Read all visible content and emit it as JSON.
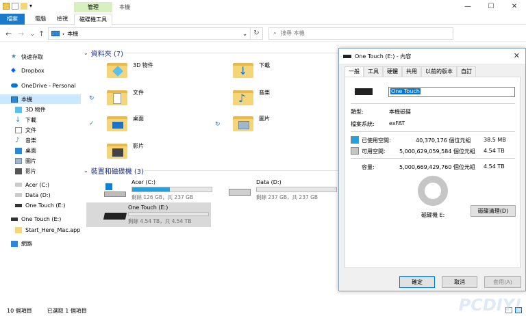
{
  "ribbon": {
    "context_header": "管理",
    "title": "本機",
    "tabs": [
      "檔案",
      "電腦",
      "檢視",
      "磁碟機工具"
    ]
  },
  "window_buttons": {
    "minimize": "—",
    "maximize": "☐",
    "close": "✕"
  },
  "address": {
    "path": "本機",
    "search_placeholder": "搜尋 本機"
  },
  "sidebar": {
    "items": [
      "快速存取",
      "Dropbox",
      "OneDrive - Personal",
      "本機",
      "3D 物件",
      "下載",
      "文件",
      "音樂",
      "桌面",
      "圖片",
      "影片",
      "Acer (C:)",
      "Data (D:)",
      "One Touch (E:)",
      "One Touch (E:)",
      "Start_Here_Mac.app",
      "網路"
    ]
  },
  "folders_group": {
    "title": "資料夾 (7)",
    "items": [
      "3D 物件",
      "下載",
      "文件",
      "音樂",
      "桌面",
      "圖片",
      "影片"
    ]
  },
  "drives_group": {
    "title": "裝置和磁碟機 (3)",
    "drives": [
      {
        "name": "Acer (C:)",
        "sub": "剩餘 126 GB，共 237 GB",
        "used_fraction": 0.47
      },
      {
        "name": "Data (D:)",
        "sub": "剩餘 237 GB，共 237 GB",
        "used_fraction": 0.0
      },
      {
        "name": "One Touch (E:)",
        "sub": "剩餘 4.54 TB，共 4.54 TB",
        "used_fraction": 0.0
      }
    ]
  },
  "status": {
    "count": "10 個項目",
    "selected": "已選取 1 個項目"
  },
  "dialog": {
    "title": "One Touch (E:) - 內容",
    "tabs": [
      "一般",
      "工具",
      "硬體",
      "共用",
      "以前的版本",
      "自訂"
    ],
    "name": "One Touch",
    "type_label": "類型:",
    "type_value": "本機磁碟",
    "fs_label": "檔案系統:",
    "fs_value": "exFAT",
    "used_label": "已使用空間:",
    "used_bytes": "40,370,176 個位元組",
    "used_size": "38.5 MB",
    "free_label": "可用空間:",
    "free_bytes": "5,000,629,059,584 個位元組",
    "free_size": "4.54 TB",
    "capacity_label": "容量:",
    "capacity_bytes": "5,000,669,429,760 個位元組",
    "capacity_size": "4.54 TB",
    "drive_label": "磁碟機 E:",
    "cleanup": "磁碟清理(D)",
    "ok": "確定",
    "cancel": "取消",
    "apply": "套用(A)",
    "used_color": "#26a0da",
    "free_color": "#c6c6c6"
  },
  "watermark": "PCDIY!"
}
